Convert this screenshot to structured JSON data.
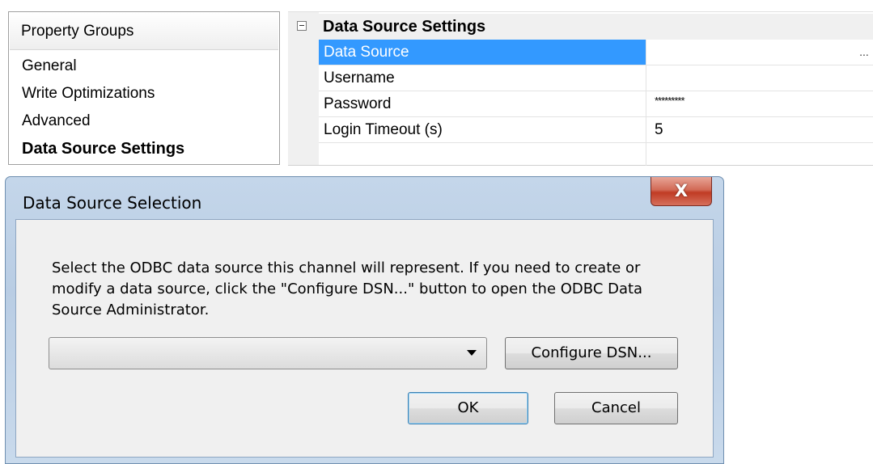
{
  "property_groups": {
    "header": "Property Groups",
    "items": [
      {
        "label": "General",
        "selected": false
      },
      {
        "label": "Write Optimizations",
        "selected": false
      },
      {
        "label": "Advanced",
        "selected": false
      },
      {
        "label": "Data Source Settings",
        "selected": true
      }
    ]
  },
  "property_grid": {
    "category": "Data Source Settings",
    "rows": [
      {
        "name": "Data Source",
        "value": "",
        "button": "...",
        "selected": true
      },
      {
        "name": "Username",
        "value": ""
      },
      {
        "name": "Password",
        "value": "*********"
      },
      {
        "name": "Login Timeout (s)",
        "value": "5"
      }
    ]
  },
  "dialog": {
    "title": "Data Source Selection",
    "close_label": "X",
    "message": "Select the ODBC data source this channel will represent. If you need to create or modify a data source, click the \"Configure DSN...\" button to open the ODBC Data Source Administrator.",
    "combo_value": "",
    "configure_label": "Configure DSN...",
    "ok_label": "OK",
    "cancel_label": "Cancel"
  },
  "colors": {
    "selection": "#3399ff",
    "dialog_frame": "#b9cde4",
    "close_button": "#c03b24"
  }
}
